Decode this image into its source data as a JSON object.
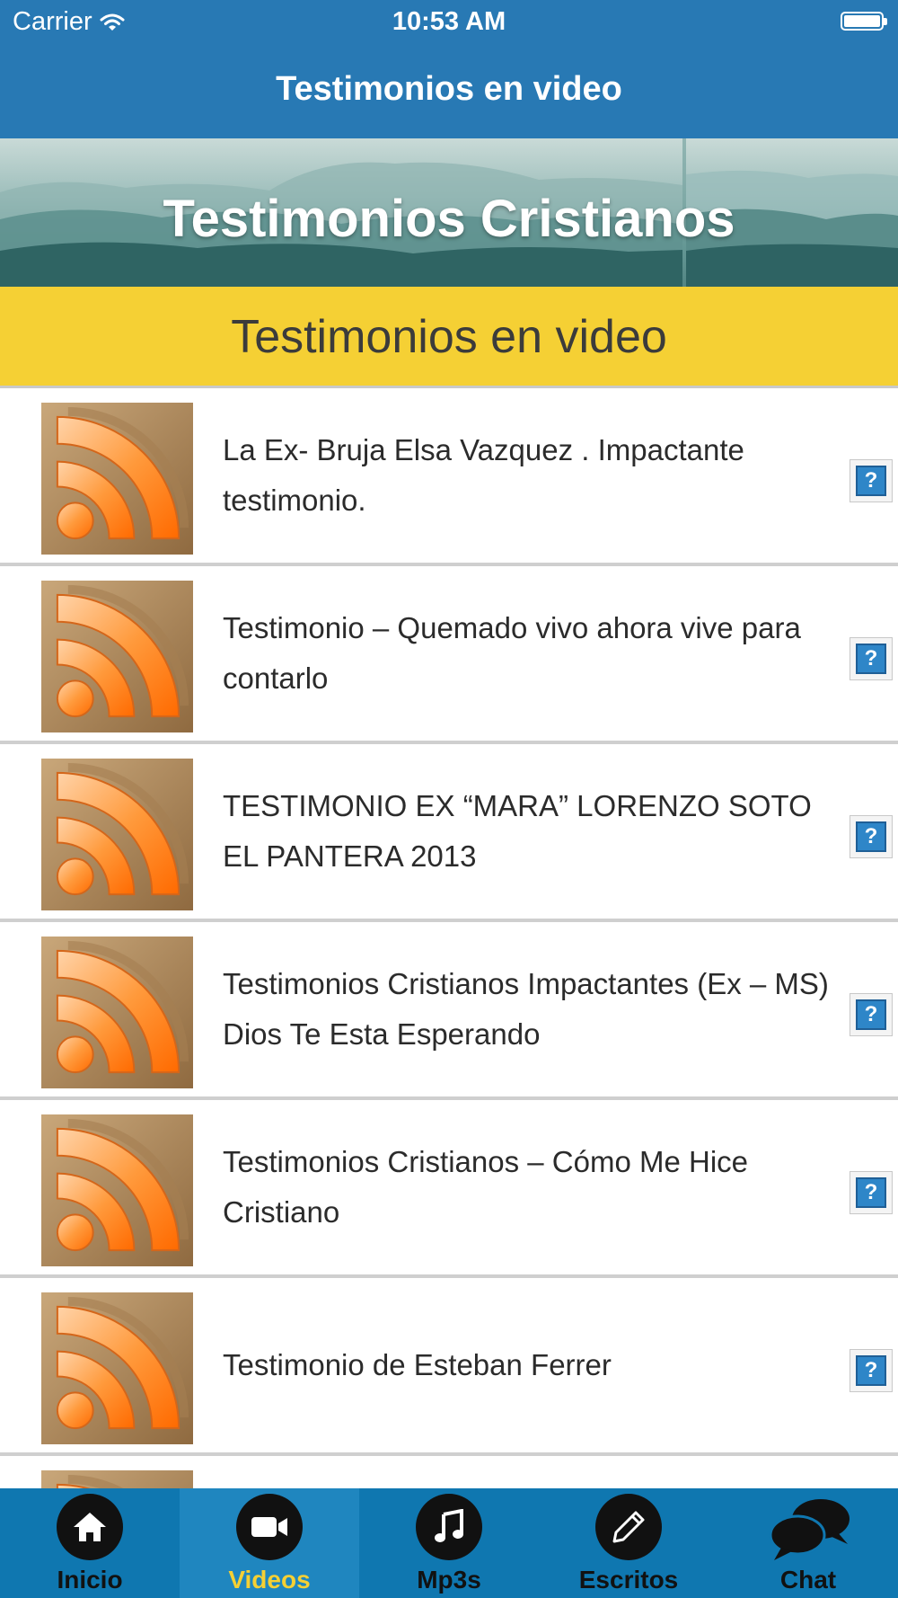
{
  "status_bar": {
    "carrier": "Carrier",
    "time": "10:53 AM"
  },
  "nav": {
    "title": "Testimonios en video"
  },
  "banner": {
    "title": "Testimonios Cristianos"
  },
  "section": {
    "title": "Testimonios en video"
  },
  "items": [
    {
      "title": "La Ex- Bruja Elsa Vazquez . Impactante testimonio.",
      "thumb_icon": "rss-icon",
      "action_icon": "help-icon"
    },
    {
      "title": "Testimonio – Quemado vivo ahora vive para contarlo",
      "thumb_icon": "rss-icon",
      "action_icon": "help-icon"
    },
    {
      "title": "TESTIMONIO EX “MARA” LORENZO SOTO EL PANTERA 2013",
      "thumb_icon": "rss-icon",
      "action_icon": "help-icon"
    },
    {
      "title": "Testimonios Cristianos Impactantes (Ex – MS) Dios Te Esta Esperando",
      "thumb_icon": "rss-icon",
      "action_icon": "help-icon"
    },
    {
      "title": "Testimonios Cristianos – Cómo Me Hice Cristiano",
      "thumb_icon": "rss-icon",
      "action_icon": "help-icon"
    },
    {
      "title": "Testimonio de Esteban Ferrer",
      "thumb_icon": "rss-icon",
      "action_icon": "help-icon"
    },
    {
      "title": "",
      "thumb_icon": "rss-icon",
      "action_icon": "help-icon"
    }
  ],
  "help_glyph": "?",
  "tabs": [
    {
      "label": "Inicio",
      "icon": "home-icon",
      "selected": false
    },
    {
      "label": "Videos",
      "icon": "video-camera-icon",
      "selected": true
    },
    {
      "label": "Mp3s",
      "icon": "music-note-icon",
      "selected": false
    },
    {
      "label": "Escritos",
      "icon": "pencil-icon",
      "selected": false
    },
    {
      "label": "Chat",
      "icon": "chat-bubbles-icon",
      "selected": false
    }
  ],
  "colors": {
    "nav_bar": "#2879b4",
    "section_header": "#f5d034",
    "tab_bar": "#0f77b0",
    "tab_selected_label": "#f5d034",
    "help_button": "#2e86c8"
  }
}
